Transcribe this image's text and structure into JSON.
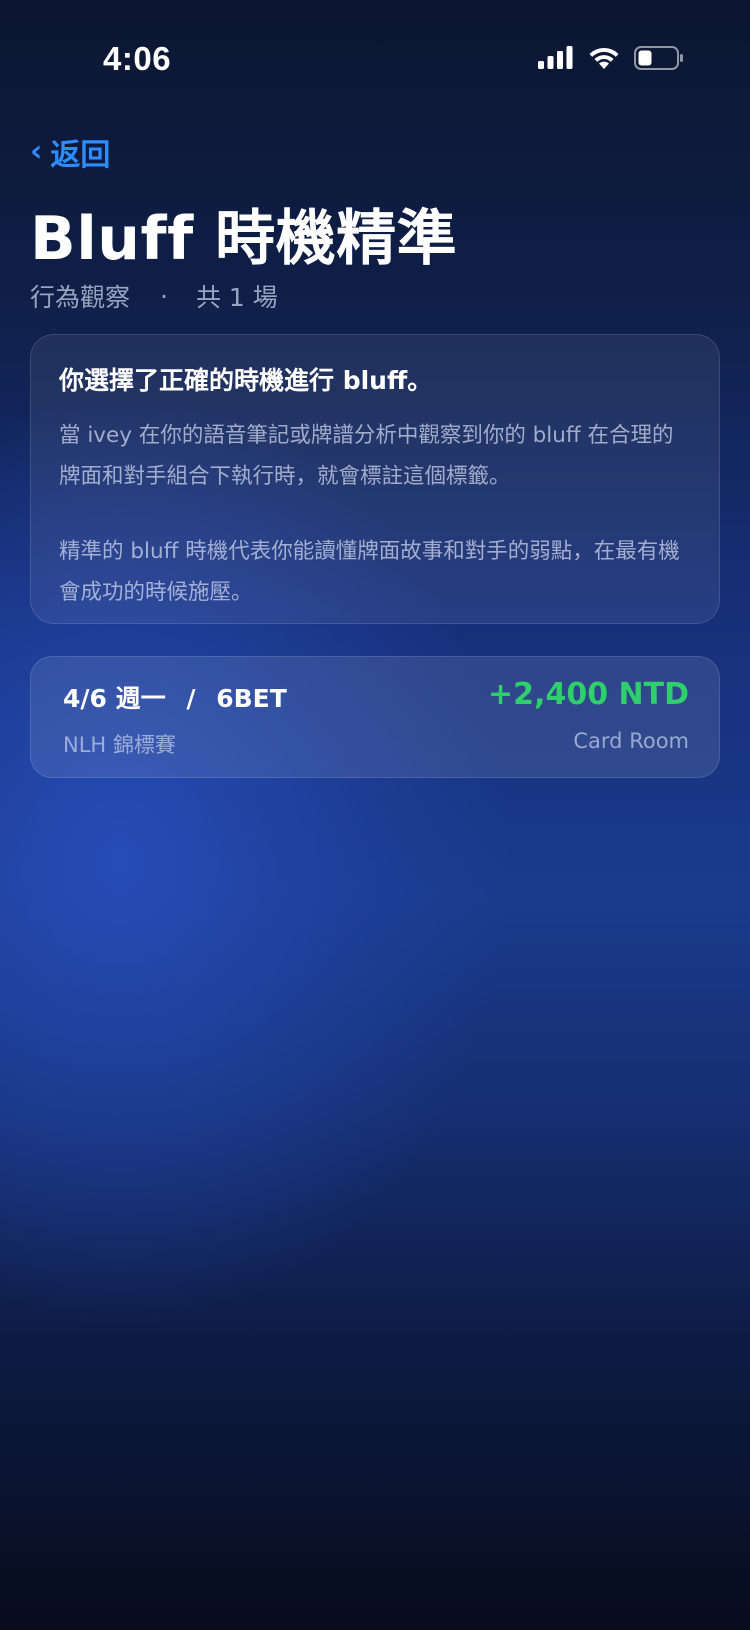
{
  "status_bar": {
    "time": "4:06",
    "icons": [
      "signal-icon",
      "wifi-icon",
      "battery-icon"
    ]
  },
  "nav": {
    "back_chevron": "‹",
    "back_label": "返回"
  },
  "header": {
    "title": "Bluff 時機精準",
    "category": "行為觀察",
    "separator": "·",
    "count": "共 1 場"
  },
  "description": {
    "heading": "你選擇了正確的時機進行 bluff。",
    "paragraphs": [
      "當 ivey 在你的語音筆記或牌譜分析中觀察到你的 bluff 在合理的牌面和對手組合下執行時，就會標註這個標籤。",
      "精準的 bluff 時機代表你能讀懂牌面故事和對手的弱點，在最有機會成功的時候施壓。"
    ]
  },
  "sessions": [
    {
      "date": "4/6 週一",
      "separator": "/",
      "tag": "6BET",
      "amount": "+2,400 NTD",
      "game": "NLH 錦標賽",
      "venue": "Card Room"
    }
  ],
  "colors": {
    "accent": "#2e8cff",
    "profit": "#2fcf6b"
  }
}
